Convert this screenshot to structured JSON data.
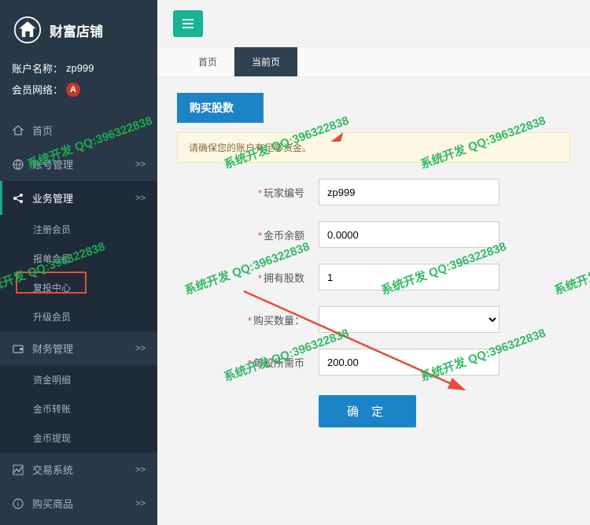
{
  "brand": {
    "title": "财富店铺"
  },
  "account": {
    "name_label": "账户名称：",
    "name_value": "zp999",
    "network_label": "会员网络：",
    "network_badge": "A"
  },
  "nav": {
    "home": "首页",
    "account_mgmt": "账号管理",
    "business_mgmt": "业务管理",
    "business_sub": {
      "register": "注册会员",
      "report": "报单会员",
      "reinvest": "复投中心",
      "upgrade": "升级会员"
    },
    "finance_mgmt": "财务管理",
    "finance_sub": {
      "detail": "资金明细",
      "transfer": "金币转账",
      "withdraw": "金币提现"
    },
    "trade_system": "交易系统",
    "buy_goods": "购买商品",
    "arrow": ">>"
  },
  "tabs": {
    "home": "首页",
    "current": "当前页"
  },
  "section": {
    "title": "购买股数"
  },
  "alert": {
    "text": "请确保您的账户有足够资金。"
  },
  "form": {
    "player_id": {
      "label": "玩家编号",
      "value": "zp999"
    },
    "gold_balance": {
      "label": "金币余额",
      "value": "0.0000"
    },
    "own_shares": {
      "label": "拥有股数",
      "value": "1"
    },
    "buy_qty": {
      "label": "购买数量："
    },
    "per_share_gold": {
      "label": "每股所需币",
      "value": "200.00"
    },
    "submit": "确 定"
  },
  "watermark": {
    "text": "系统开发 QQ:396322838"
  }
}
